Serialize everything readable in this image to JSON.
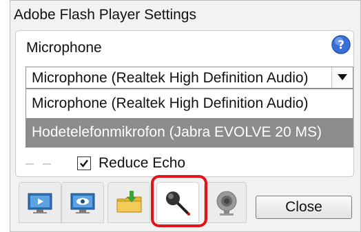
{
  "window": {
    "title": "Adobe Flash Player Settings"
  },
  "section": {
    "title": "Microphone",
    "help_icon": "help-icon"
  },
  "microphone_select": {
    "selected_value": "Microphone (Realtek High Definition Audio)",
    "options": [
      "Microphone (Realtek High Definition Audio)",
      "Hodetelefonmikrofon (Jabra EVOLVE 20 MS)"
    ],
    "highlighted_option": 1
  },
  "reduce_echo": {
    "label": "Reduce Echo",
    "checked": true
  },
  "tabs": [
    {
      "icon": "display-icon",
      "active": false
    },
    {
      "icon": "privacy-eye-icon",
      "active": false
    },
    {
      "icon": "local-storage-icon",
      "active": false
    },
    {
      "icon": "microphone-icon",
      "active": true
    },
    {
      "icon": "webcam-icon",
      "active": false
    }
  ],
  "buttons": {
    "close": "Close"
  },
  "colors": {
    "highlight": "#e0151b",
    "selected_option_bg": "#8c8c8c",
    "help_icon": "#3a6fd8"
  }
}
